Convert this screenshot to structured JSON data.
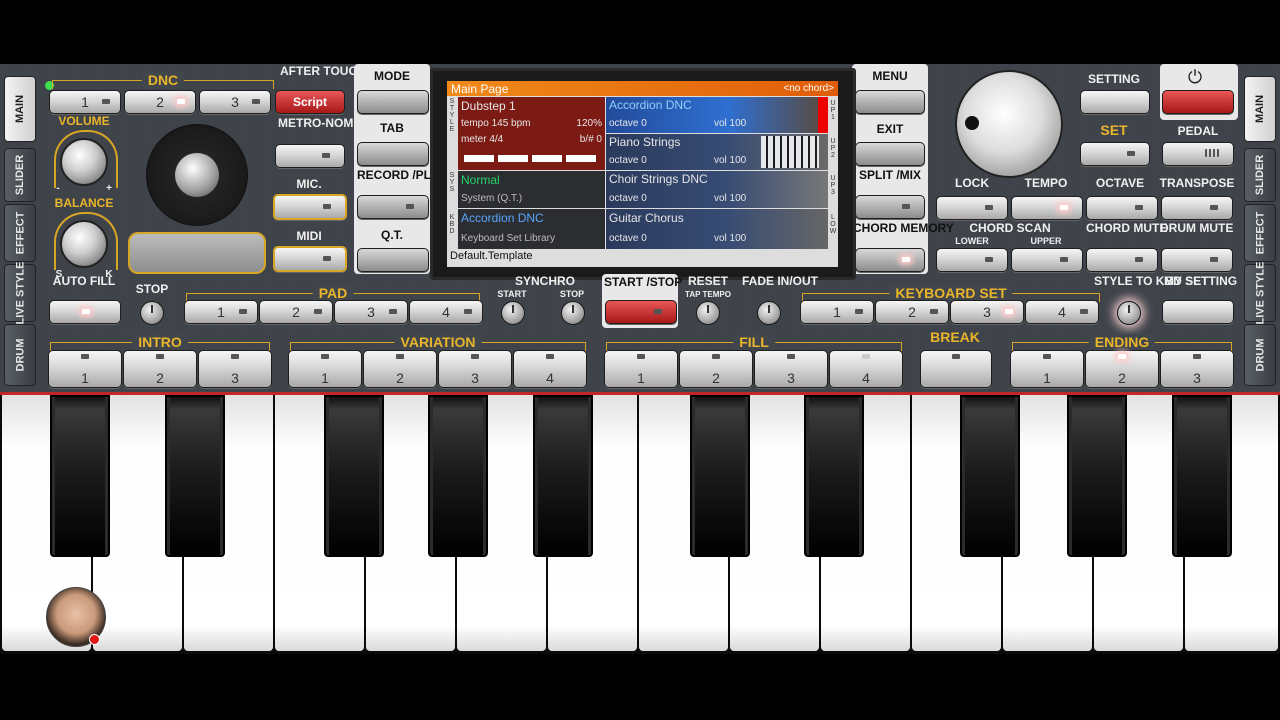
{
  "sidebar_left": [
    "MAIN",
    "SLIDER",
    "EFFECT",
    "LIVE STYLE",
    "DRUM"
  ],
  "sidebar_right": [
    "MAIN",
    "SLIDER",
    "EFFECT",
    "LIVE STYLE",
    "DRUM"
  ],
  "dnc": {
    "label": "DNC",
    "buttons": [
      "1",
      "2",
      "3"
    ],
    "script_label": "Script"
  },
  "labels": {
    "after_touch": "AFTER TOUCH",
    "volume": "VOLUME",
    "balance": "BALANCE",
    "metronome": "METRO-NOME",
    "mic": "MIC.",
    "midi": "MIDI",
    "auto_fill": "AUTO FILL",
    "stop": "STOP",
    "mode": "MODE",
    "tab": "TAB",
    "record_play": "RECORD /PLAY",
    "qt": "Q.T.",
    "menu": "MENU",
    "exit": "EXIT",
    "split_mix": "SPLIT /MIX",
    "chord_memory": "CHORD MEMORY",
    "setting": "SETTING",
    "set": "SET",
    "pedal": "PEDAL",
    "lock": "LOCK",
    "tempo": "TEMPO",
    "octave": "OCTAVE",
    "transpose": "TRANSPOSE",
    "chord_scan": "CHORD SCAN",
    "lower": "LOWER",
    "upper": "UPPER",
    "chord_mute": "CHORD MUTE",
    "drum_mute": "DRUM MUTE",
    "synchro": "SYNCHRO",
    "sync_start": "START",
    "sync_stop": "STOP",
    "start_stop": "START /STOP",
    "reset": "RESET",
    "tap_tempo": "TAP TEMPO",
    "fade": "FADE IN/OUT",
    "style_to_kbd": "STYLE TO KBD SET",
    "my_setting": "MY SETTING",
    "balance_s": "S",
    "balance_k": "K",
    "vol_minus": "-",
    "vol_plus": "+"
  },
  "pad": {
    "label": "PAD",
    "buttons": [
      "1",
      "2",
      "3",
      "4"
    ]
  },
  "keyboard_set": {
    "label": "KEYBOARD SET",
    "buttons": [
      "1",
      "2",
      "3",
      "4"
    ]
  },
  "intro": {
    "label": "INTRO",
    "buttons": [
      "1",
      "2",
      "3"
    ]
  },
  "variation": {
    "label": "VARIATION",
    "buttons": [
      "1",
      "2",
      "3",
      "4"
    ]
  },
  "fill": {
    "label": "FILL",
    "buttons": [
      "1",
      "2",
      "3",
      "4"
    ]
  },
  "break_label": "BREAK",
  "ending": {
    "label": "ENDING",
    "buttons": [
      "1",
      "2",
      "3"
    ]
  },
  "screen": {
    "title": "Main Page",
    "chord": "<no chord>",
    "side_style": "STYLE",
    "side_sys": "SYS",
    "side_kbd": "KBD",
    "style_name": "Dubstep 1",
    "tempo": "tempo 145 bpm",
    "tempo_pct": "120%",
    "meter": "meter 4/4",
    "bsharp": "b/# 0",
    "sys_mode": "Normal",
    "sys_sub": "System (Q.T.)",
    "kbd_name": "Accordion DNC",
    "kbd_sub": "Keyboard Set Library",
    "template": "Default.Template",
    "parts": [
      {
        "name": "Accordion DNC",
        "octave": "octave  0",
        "vol": "vol 100",
        "side": "UP1"
      },
      {
        "name": "Piano Strings",
        "octave": "octave  0",
        "vol": "vol 100",
        "side": "UP2"
      },
      {
        "name": "Choir Strings DNC",
        "octave": "octave  0",
        "vol": "vol 100",
        "side": "UP3"
      },
      {
        "name": "Guitar Chorus",
        "octave": "octave  0",
        "vol": "vol 100",
        "side": "LOW"
      }
    ]
  },
  "colors": {
    "accent": "#e9b52a",
    "screen_header": "#f07a14",
    "active_part": "#2f6fd1",
    "sys_green": "#27d36b"
  }
}
